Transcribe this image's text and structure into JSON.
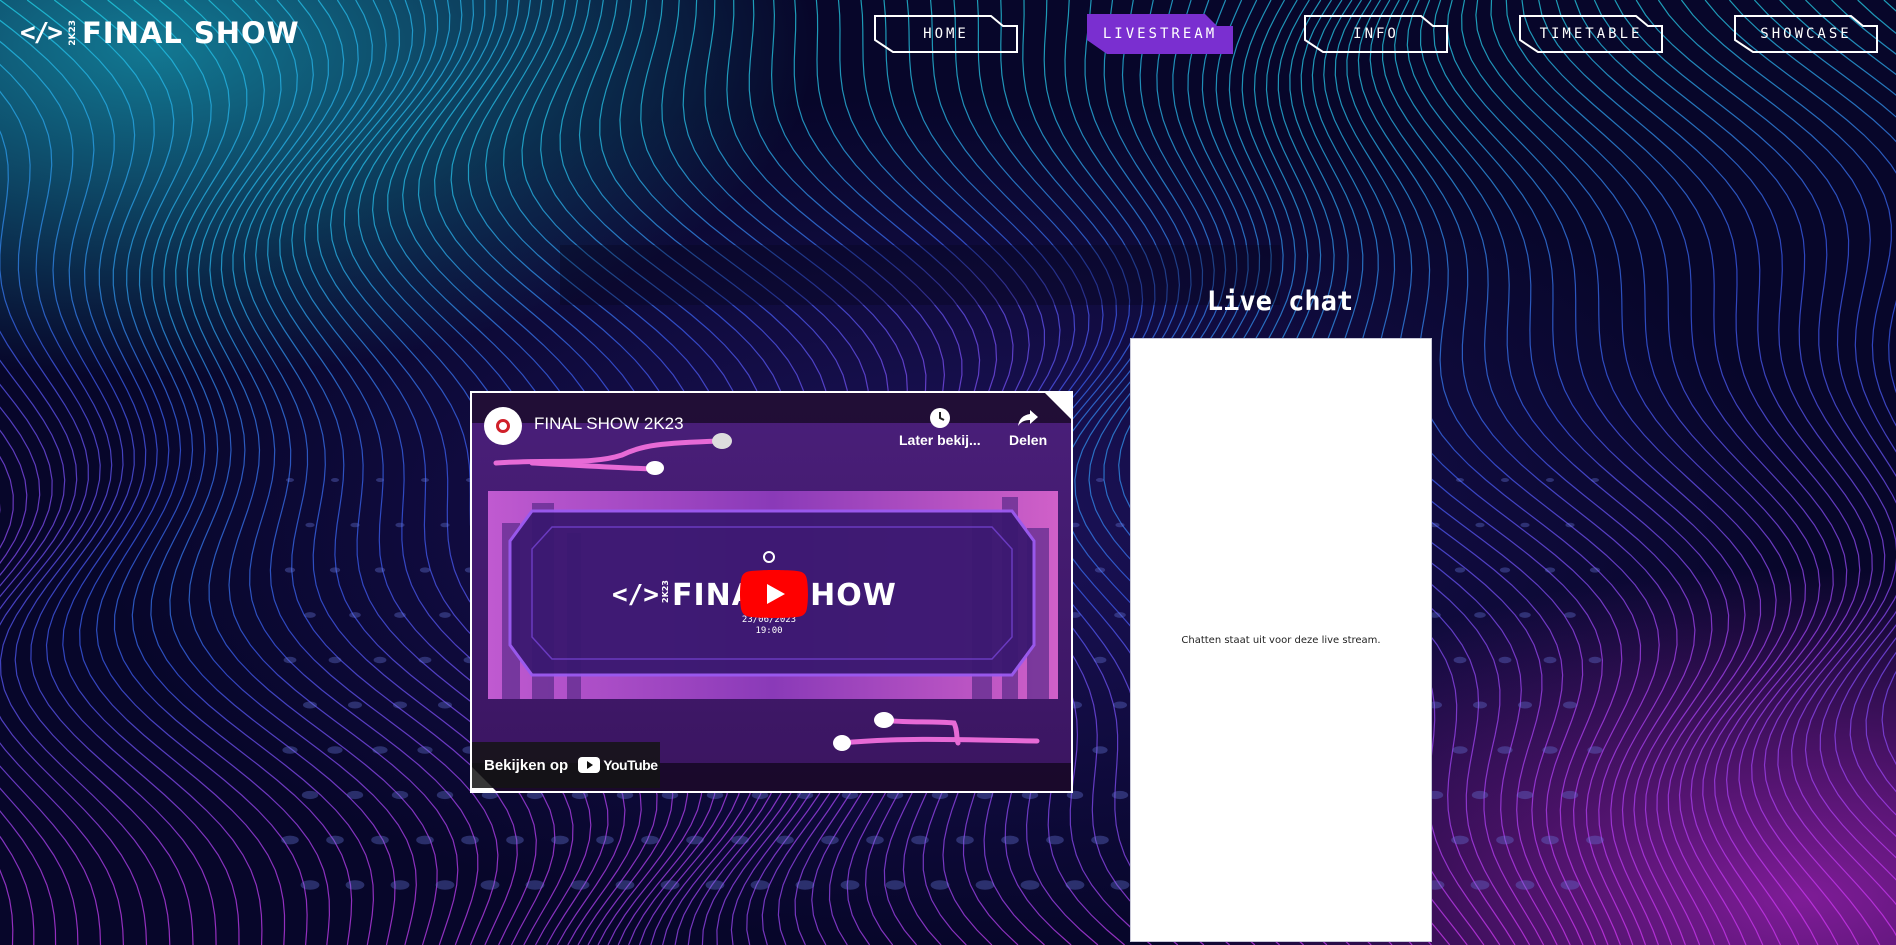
{
  "logo": {
    "code": "</>",
    "year": "2K23",
    "name": "FINAL SHOW"
  },
  "nav": {
    "items": [
      {
        "label": "HOME",
        "active": false
      },
      {
        "label": "LIVESTREAM",
        "active": true
      },
      {
        "label": "INFO",
        "active": false
      },
      {
        "label": "TIMETABLE",
        "active": false
      },
      {
        "label": "SHOWCASE",
        "active": false
      }
    ]
  },
  "video": {
    "title": "FINAL SHOW 2K23",
    "watch_later": "Later bekij...",
    "share": "Delen",
    "watch_on": "Bekijken op",
    "youtube": "YouTube",
    "thumb_logo_code": "</>",
    "thumb_logo_year": "2K23",
    "thumb_logo_name": "FINAL SHOW",
    "thumb_date": "23/06/2023",
    "thumb_time": "19:00"
  },
  "chat": {
    "title": "Live chat",
    "message": "Chatten staat uit voor deze live stream."
  },
  "colors": {
    "accent": "#7a2fd0",
    "play_red": "#ff0000"
  }
}
